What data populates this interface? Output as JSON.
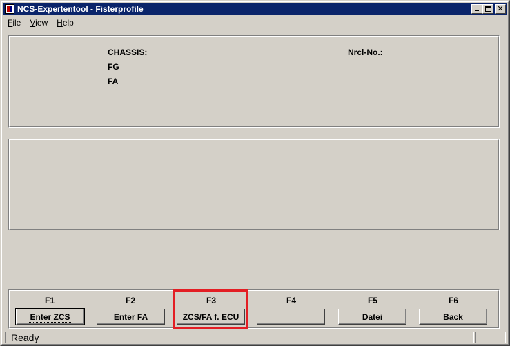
{
  "window": {
    "title": "NCS-Expertentool - Fisterprofile",
    "controls": {
      "minimize": "minimize",
      "maximize": "maximize",
      "close": "✕"
    }
  },
  "menu": [
    {
      "label": "ile",
      "mnemonic": "F"
    },
    {
      "label": "iew",
      "mnemonic": "V"
    },
    {
      "label": "elp",
      "mnemonic": "H"
    }
  ],
  "info": {
    "chassis_label": "CHASSIS:",
    "fg_label": "FG",
    "fa_label": "FA",
    "nrcl_label": "Nrcl-No.:"
  },
  "function_keys": [
    {
      "key": "F1",
      "button": "Enter ZCS"
    },
    {
      "key": "F2",
      "button": "Enter FA"
    },
    {
      "key": "F3",
      "button": "ZCS/FA f. ECU"
    },
    {
      "key": "F4",
      "button": ""
    },
    {
      "key": "F5",
      "button": "Datei"
    },
    {
      "key": "F6",
      "button": "Back"
    }
  ],
  "status": {
    "text": "Ready"
  },
  "colors": {
    "title_bar": "#0a246a",
    "highlight": "#e31e24",
    "face": "#d4d0c8"
  }
}
